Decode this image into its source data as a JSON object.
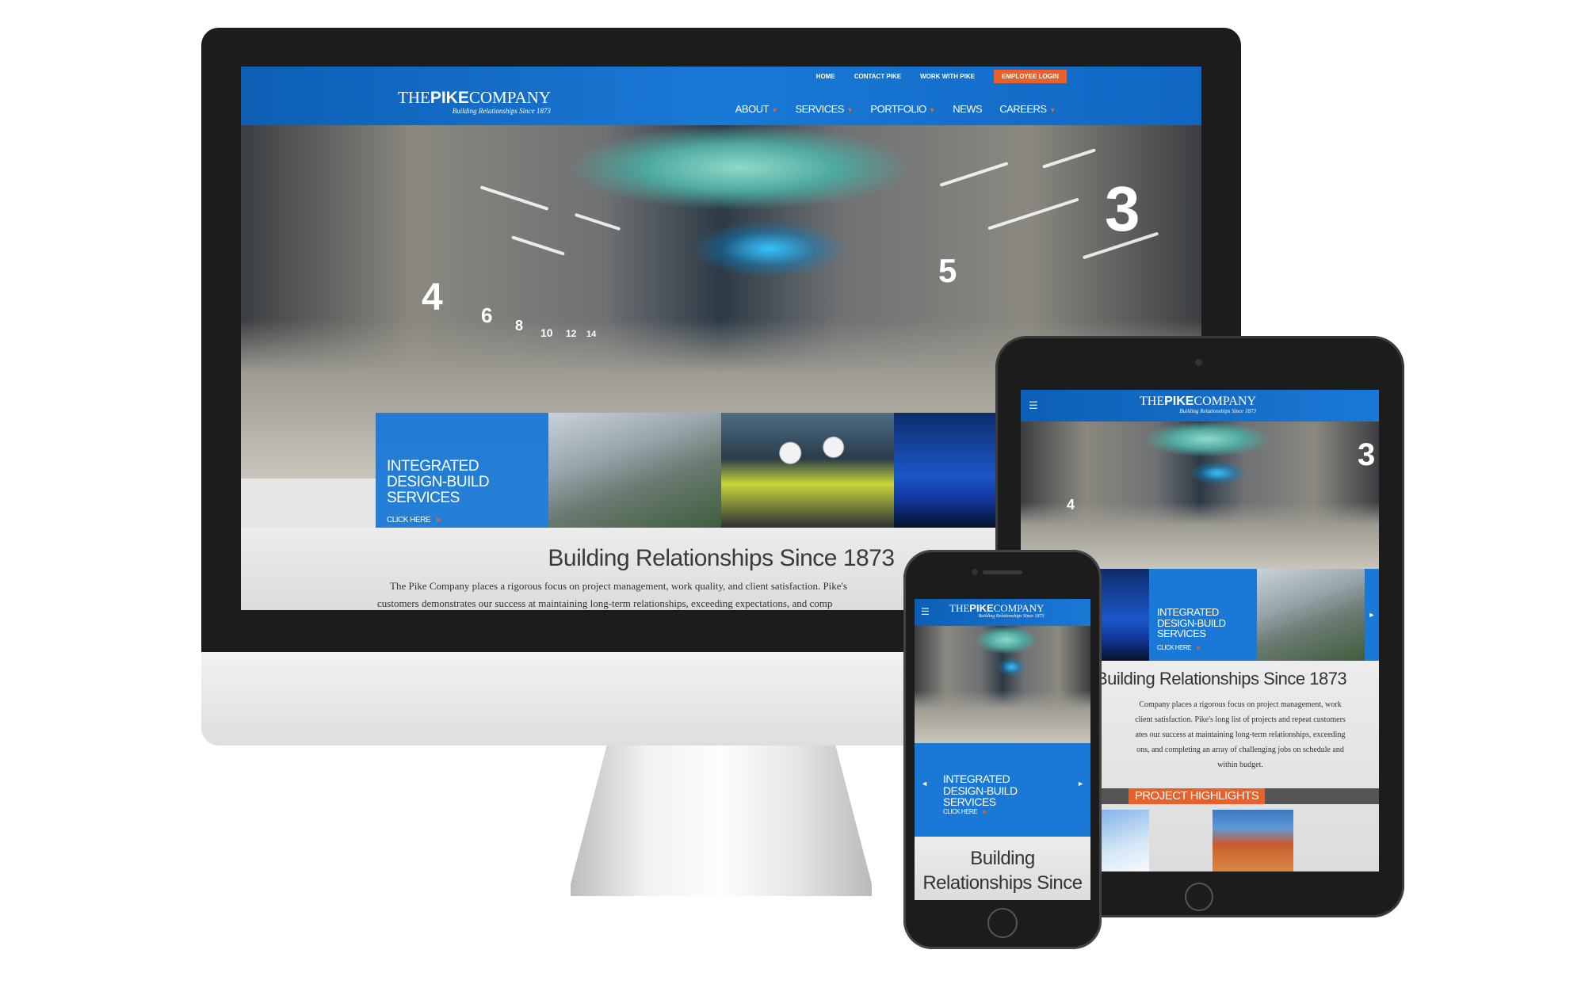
{
  "site": {
    "logo_prefix": "THE",
    "logo_bold": "PIKE",
    "logo_suffix": "COMPANY",
    "tagline": "Building Relationships Since 1873"
  },
  "top_links": [
    "HOME",
    "CONTACT PIKE",
    "WORK WITH PIKE",
    "EMPLOYEE LOGIN"
  ],
  "nav": [
    "ABOUT",
    "SERVICES",
    "PORTFOLIO",
    "NEWS",
    "CAREERS"
  ],
  "hero": {
    "cta_title_desktop": "INTEGRATED DESIGN-BUILD SERVICES",
    "cta_title_tablet": "INTEGRATED DESIGN-BUILD SERVICES",
    "cta_title_phone": "INTEGRATED DESIGN-BUILD SERVICES",
    "cta_link": "CLICK HERE"
  },
  "intro": {
    "heading": "Building Relationships Since 1873",
    "heading_phone": "Building Relationships Since",
    "desktop_line1": "The Pike Company places a rigorous focus on project management, work quality, and client satisfaction. Pike's",
    "desktop_line2": "customers demonstrates our success at maintaining long-term relationships, exceeding expectations, and comp",
    "tablet_lines": [
      "Company places a rigorous focus on project management, work",
      "client satisfaction. Pike's long list of projects and repeat customers",
      "ates our success at maintaining long-term relationships, exceeding",
      "ons, and completing an array of challenging jobs on schedule and",
      "within budget."
    ]
  },
  "tablet": {
    "project_highlights": "PROJECT HIGHLIGHTS"
  },
  "hero_signage": [
    "4",
    "6",
    "8",
    "10",
    "12",
    "14",
    "5",
    "3"
  ],
  "colors": {
    "brand_blue": "#1a79d6",
    "brand_blue_dark": "#0d5fb5",
    "accent_orange": "#e8602c",
    "device_black": "#1c1c1c"
  },
  "icons": {
    "menu": "hamburger-icon",
    "arrow_left": "chevron-left-icon",
    "arrow_right": "chevron-right-icon"
  }
}
